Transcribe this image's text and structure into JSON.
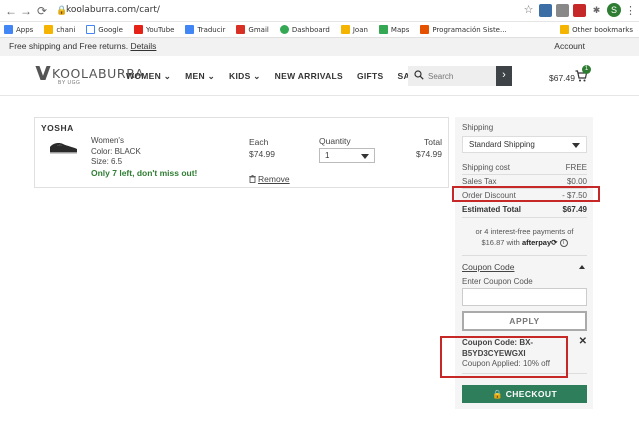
{
  "browser": {
    "url": "koolaburra.com/cart/",
    "bookmarks": [
      "Apps",
      "chani",
      "Google",
      "YouTube",
      "Traducir",
      "Gmail",
      "Dashboard",
      "Joan",
      "Maps",
      "Programación Siste..."
    ],
    "other_bookmarks": "Other bookmarks",
    "profile_initial": "S",
    "colors": {
      "youtube": "#e62117",
      "gmail": "#d93025",
      "dashboard": "#34a853",
      "programacion": "#e65100"
    }
  },
  "promo": {
    "text": "Free shipping and Free returns.",
    "details_link": "Details",
    "account": "Account"
  },
  "header": {
    "logo": "KOOLABURRA",
    "logo_sub": "BY UGG",
    "nav": [
      "WOMEN",
      "MEN",
      "KIDS",
      "NEW ARRIVALS",
      "GIFTS",
      "SALE"
    ],
    "search_placeholder": "Search",
    "cart_total": "$67.49",
    "cart_count": "1"
  },
  "item": {
    "brand": "YOSHA",
    "gender": "Women's",
    "color": "Color: BLACK",
    "size": "Size: 6.5",
    "stock": "Only 7 left, don't miss out!",
    "each_label": "Each",
    "each_price": "$74.99",
    "qty_label": "Quantity",
    "qty_value": "1",
    "total_label": "Total",
    "total_price": "$74.99",
    "remove": "Remove"
  },
  "summary": {
    "shipping_label": "Shipping",
    "shipping_option": "Standard Shipping",
    "shipping_cost_label": "Shipping cost",
    "shipping_cost": "FREE",
    "sales_tax_label": "Sales Tax",
    "sales_tax": "$0.00",
    "discount_label": "Order Discount",
    "discount": "- $7.50",
    "estimated_label": "Estimated Total",
    "estimated": "$67.49",
    "afterpay_line1": "or 4 interest-free payments of",
    "afterpay_amount": "$16.87 with",
    "afterpay_brand": "afterpay",
    "coupon_heading": "Coupon Code",
    "coupon_input_label": "Enter Coupon Code",
    "apply": "APPLY",
    "coupon_code": "Coupon Code: BX-B5YD3CYEWGXI",
    "coupon_applied": "Coupon Applied: 10% off",
    "checkout": "CHECKOUT",
    "accent": "#2e7d5b"
  }
}
